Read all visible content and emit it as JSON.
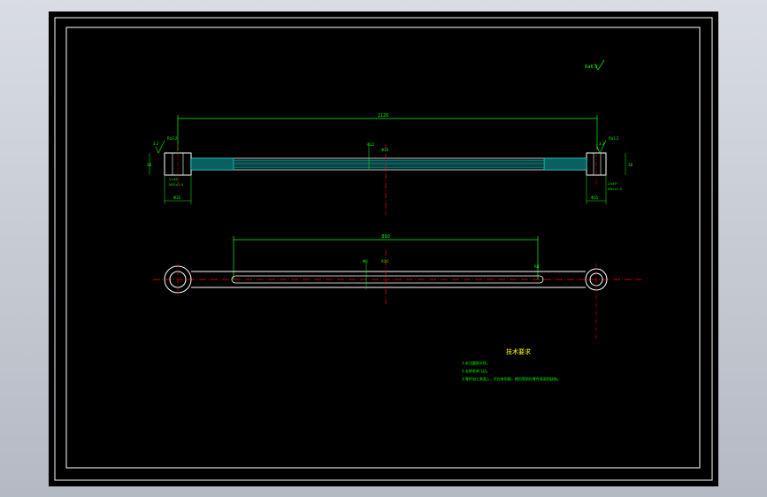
{
  "drawing": {
    "title_block": {
      "heading": "技术要求",
      "notes": [
        "1.未注圆角半径。",
        "2.去除毛刺飞边。",
        "3.零件加工表面上，不应有划痕，擦伤等损伤零件表面的缺陷。"
      ]
    },
    "roughness_general": "Ra6.3",
    "dimensions": {
      "overall_length": "1120",
      "slot_length": "890",
      "left_roughness": "Ra3.2",
      "right_roughness": "Ra3.2",
      "left_surface_value": "3.2",
      "right_surface_value": "3.2",
      "end_height": "38",
      "end_height_right": "38",
      "left_bore": "Φ35",
      "right_bore": "Φ35",
      "left_chamfer": "2×45°",
      "right_chamfer": "2×45°",
      "left_thread": "M20×1.5",
      "right_thread": "M20×1.5",
      "mid_label_1": "Φ22",
      "mid_label_2": "Φ20",
      "slot_mark_1": "Φ8",
      "slot_mark_2": "R10",
      "slot_mark_3": "R8"
    },
    "colors": {
      "background": "#000000",
      "frame": "#ffffff",
      "geometry": "#ffffff",
      "dimension": "#00ff00",
      "centerline": "#ff0000",
      "hatch": "#00ffff",
      "text_note": "#ffff00"
    }
  }
}
